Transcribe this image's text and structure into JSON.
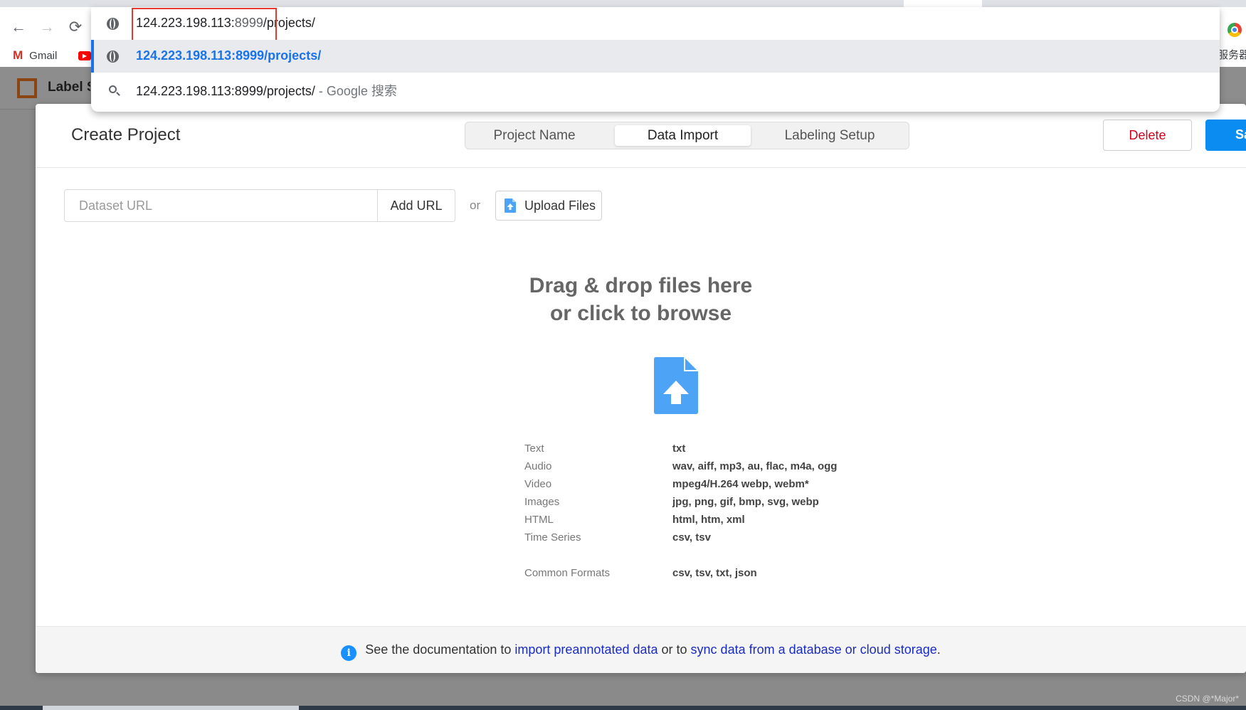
{
  "browser": {
    "nav": {
      "back": "←",
      "forward": "→",
      "reload": "⟳"
    },
    "omnibox": {
      "typed_text": "124.223.198.113:",
      "autocomplete_text": "8999",
      "rest_text": "/projects/",
      "suggestion_url": "124.223.198.113:8999/projects/",
      "suggestion_search_query": "124.223.198.113:8999/projects/",
      "suggestion_search_suffix": " - Google 搜索"
    },
    "bookmarks": [
      {
        "icon": "gmail-icon",
        "glyph": "M",
        "label": "Gmail"
      },
      {
        "icon": "youtube-icon",
        "glyph": "▶",
        "label": ""
      }
    ],
    "bookmarks_right_label": "服务器"
  },
  "app": {
    "name": "Label Studio"
  },
  "modal": {
    "title": "Create Project",
    "steps": [
      {
        "label": "Project Name",
        "active": false
      },
      {
        "label": "Data Import",
        "active": true
      },
      {
        "label": "Labeling Setup",
        "active": false
      }
    ],
    "delete_label": "Delete",
    "save_label": "Save",
    "url_placeholder": "Dataset URL",
    "add_url_label": "Add URL",
    "or_label": "or",
    "upload_label": "Upload Files",
    "drop_title_line1": "Drag & drop files here",
    "drop_title_line2": "or click to browse",
    "formats": [
      {
        "label": "Text",
        "value": "txt"
      },
      {
        "label": "Audio",
        "value": "wav, aiff, mp3, au, flac, m4a, ogg"
      },
      {
        "label": "Video",
        "value": "mpeg4/H.264 webp, webm*"
      },
      {
        "label": "Images",
        "value": "jpg, png, gif, bmp, svg, webp"
      },
      {
        "label": "HTML",
        "value": "html, htm, xml"
      },
      {
        "label": "Time Series",
        "value": "csv, tsv"
      }
    ],
    "common_formats": {
      "label": "Common Formats",
      "value": "csv, tsv, txt, json"
    },
    "footer": {
      "text_before": "See the documentation to ",
      "link1": "import preannotated data",
      "text_middle": " or to ",
      "link2": "sync data from a database or cloud storage",
      "text_after": "."
    }
  },
  "watermark": "CSDN @*Major*",
  "colors": {
    "primary": "#0b8cf0",
    "danger": "#d0021b",
    "link": "#1a2dc2",
    "upload_icon": "#4da3f5",
    "highlight_box": "#e53935"
  }
}
